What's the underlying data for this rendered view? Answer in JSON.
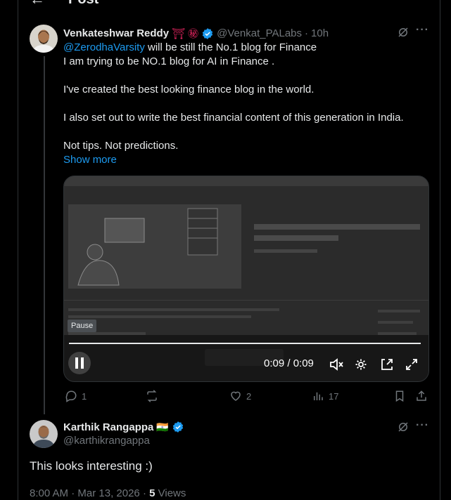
{
  "header": {
    "back_icon": "arrow-left-icon",
    "title": "Post"
  },
  "post1": {
    "author_name": "Venkateshwar Reddy",
    "emoji_1": "⛩",
    "emoji_2": "㊙",
    "handle": "@Venkat_PALabs",
    "separator": "·",
    "time": "10h",
    "mention": "@ZerodhaVarsity",
    "line1_rest": " will be still the No.1 blog for Finance",
    "line2": "I am  trying to be NO.1 blog for  AI in Finance .",
    "line3": "I've created the best looking finance blog in the world.",
    "line4": "I also set out to write the best financial content of this generation in India.",
    "line5": "Not tips. Not predictions.",
    "show_more": "Show more",
    "video": {
      "pause_label": "Pause",
      "time": "0:09 / 0:09"
    },
    "actions": {
      "replies": "1",
      "reposts": "",
      "likes": "2",
      "views": "17"
    }
  },
  "post2": {
    "author_name": "Karthik Rangappa",
    "flag": "🇮🇳",
    "handle": "@karthikrangappa",
    "text": "This looks interesting :)",
    "time": "8:00 AM",
    "date": "Mar 13, 2026",
    "separator": "·",
    "views_count": "5",
    "views_label": "Views"
  },
  "colors": {
    "background": "#000000",
    "text": "#e7e9ea",
    "muted": "#71767b",
    "accent": "#1d9bf0",
    "border": "#2f3336"
  }
}
